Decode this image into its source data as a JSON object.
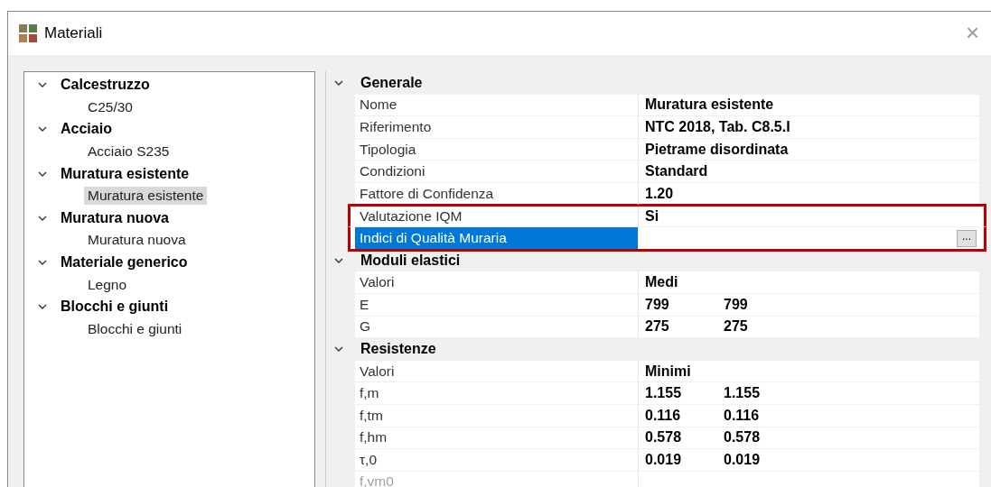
{
  "window": {
    "title": "Materiali",
    "close": "×"
  },
  "tree": [
    {
      "label": "Calcestruzzo",
      "expanded": true,
      "children": [
        {
          "label": "C25/30",
          "selected": false
        }
      ]
    },
    {
      "label": "Acciaio",
      "expanded": true,
      "children": [
        {
          "label": "Acciaio S235",
          "selected": false
        }
      ]
    },
    {
      "label": "Muratura esistente",
      "expanded": true,
      "children": [
        {
          "label": "Muratura esistente",
          "selected": true
        }
      ]
    },
    {
      "label": "Muratura nuova",
      "expanded": true,
      "children": [
        {
          "label": "Muratura nuova",
          "selected": false
        }
      ]
    },
    {
      "label": "Materiale generico",
      "expanded": true,
      "children": [
        {
          "label": "Legno",
          "selected": false
        }
      ]
    },
    {
      "label": "Blocchi e giunti",
      "expanded": true,
      "children": [
        {
          "label": "Blocchi e giunti",
          "selected": false
        }
      ]
    }
  ],
  "properties": [
    {
      "category": "Generale",
      "expanded": true,
      "rows": [
        {
          "name": "Nome",
          "values": [
            "Muratura esistente"
          ],
          "selected": false,
          "disabled": false,
          "highlighted": false
        },
        {
          "name": "Riferimento",
          "values": [
            "NTC 2018, Tab. C8.5.I"
          ],
          "selected": false,
          "disabled": false,
          "highlighted": false
        },
        {
          "name": "Tipologia",
          "values": [
            "Pietrame disordinata"
          ],
          "selected": false,
          "disabled": false,
          "highlighted": false
        },
        {
          "name": "Condizioni",
          "values": [
            "Standard"
          ],
          "selected": false,
          "disabled": false,
          "highlighted": false
        },
        {
          "name": "Fattore di Confidenza",
          "values": [
            "1.20"
          ],
          "selected": false,
          "disabled": false,
          "highlighted": false
        },
        {
          "name": "Valutazione IQM",
          "values": [
            "Si"
          ],
          "selected": false,
          "disabled": false,
          "highlighted": true
        },
        {
          "name": "Indici di Qualità Muraria",
          "values": [],
          "button": "...",
          "selected": true,
          "disabled": false,
          "highlighted": true
        }
      ]
    },
    {
      "category": "Moduli elastici",
      "expanded": true,
      "rows": [
        {
          "name": "Valori",
          "values": [
            "Medi"
          ],
          "selected": false,
          "disabled": false,
          "highlighted": false
        },
        {
          "name": "E",
          "values": [
            "799",
            "799"
          ],
          "selected": false,
          "disabled": false,
          "highlighted": false
        },
        {
          "name": "G",
          "values": [
            "275",
            "275"
          ],
          "selected": false,
          "disabled": false,
          "highlighted": false
        }
      ]
    },
    {
      "category": "Resistenze",
      "expanded": true,
      "rows": [
        {
          "name": "Valori",
          "values": [
            "Minimi"
          ],
          "selected": false,
          "disabled": false,
          "highlighted": false
        },
        {
          "name": "f,m",
          "values": [
            "1.155",
            "1.155"
          ],
          "selected": false,
          "disabled": false,
          "highlighted": false
        },
        {
          "name": "f,tm",
          "values": [
            "0.116",
            "0.116"
          ],
          "selected": false,
          "disabled": false,
          "highlighted": false
        },
        {
          "name": "f,hm",
          "values": [
            "0.578",
            "0.578"
          ],
          "selected": false,
          "disabled": false,
          "highlighted": false
        },
        {
          "name": "τ,0",
          "values": [
            "0.019",
            "0.019"
          ],
          "selected": false,
          "disabled": false,
          "highlighted": false
        },
        {
          "name": "f,vm0",
          "values": [],
          "selected": false,
          "disabled": true,
          "highlighted": false
        }
      ]
    }
  ]
}
